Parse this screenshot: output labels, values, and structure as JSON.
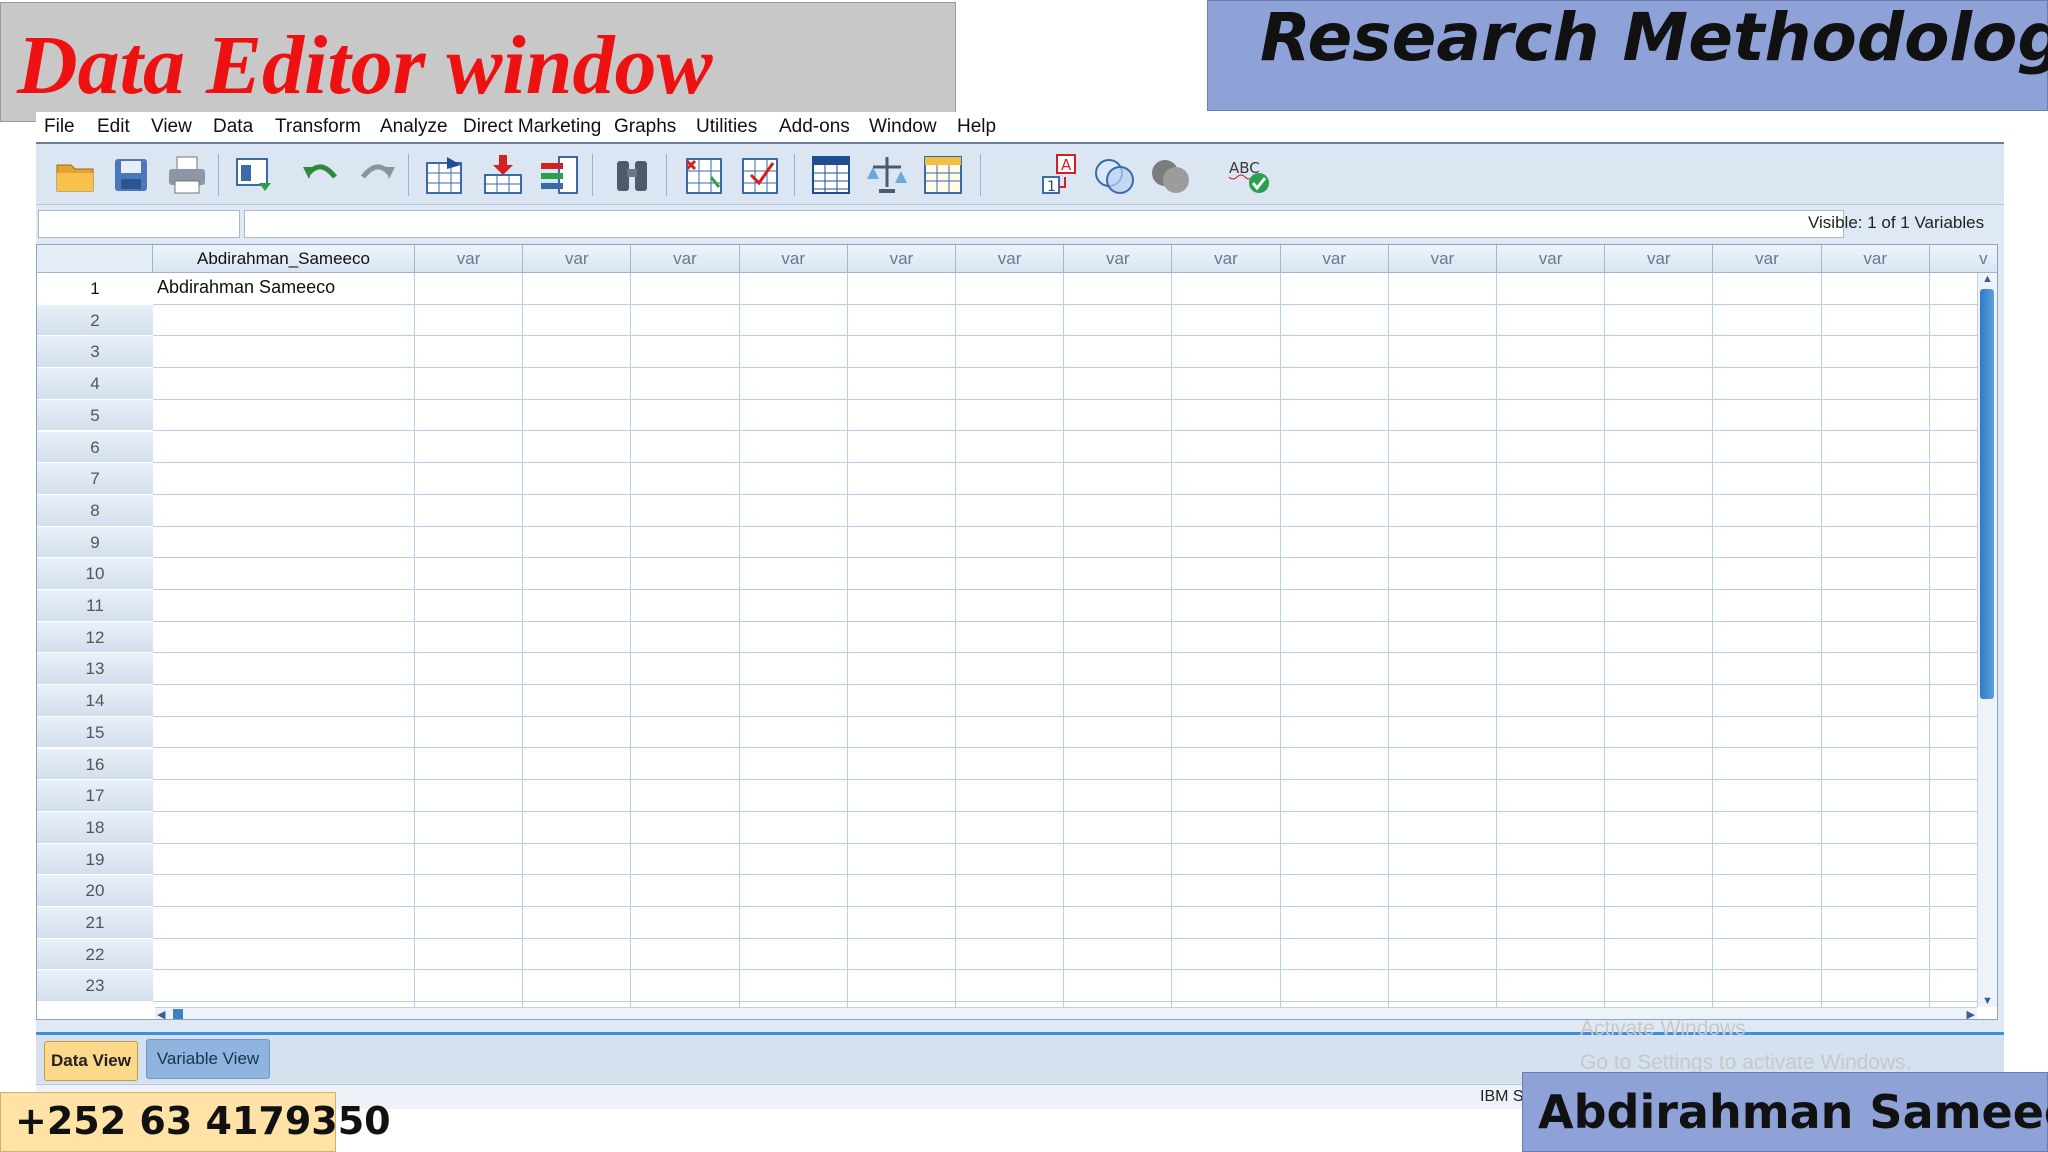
{
  "overlay": {
    "title": "Data Editor window",
    "course": "Research Methodology",
    "phone": "+252 63 4179350",
    "author": "Abdirahman Sameeco,"
  },
  "menu": [
    "File",
    "Edit",
    "View",
    "Data",
    "Transform",
    "Analyze",
    "Direct Marketing",
    "Graphs",
    "Utilities",
    "Add-ons",
    "Window",
    "Help"
  ],
  "toolbar": {
    "icons": [
      "open-folder-icon",
      "save-icon",
      "print-icon",
      "dialog-recall-icon",
      "undo-icon",
      "redo-icon",
      "goto-case-icon",
      "goto-variable-icon",
      "variables-icon",
      "find-icon",
      "insert-cases-icon",
      "insert-variable-icon",
      "split-file-icon",
      "weight-cases-icon",
      "select-cases-icon",
      "value-labels-icon",
      "use-sets-icon",
      "show-all-variables-icon",
      "spell-check-icon"
    ]
  },
  "status": {
    "visible": "Visible: 1 of 1 Variables",
    "footer": "IBM S"
  },
  "grid": {
    "columns": [
      "Abdirahman_Sameeco",
      "var",
      "var",
      "var",
      "var",
      "var",
      "var",
      "var",
      "var",
      "var",
      "var",
      "var",
      "var",
      "var",
      "var",
      "v"
    ],
    "rows": [
      "1",
      "2",
      "3",
      "4",
      "5",
      "6",
      "7",
      "8",
      "9",
      "10",
      "11",
      "12",
      "13",
      "14",
      "15",
      "16",
      "17",
      "18",
      "19",
      "20",
      "21",
      "22",
      "23"
    ],
    "cell_1_1": "Abdirahman Sameeco"
  },
  "tabs": {
    "data_view": "Data View",
    "variable_view": "Variable View"
  },
  "watermark": {
    "line1": "Activate Windows",
    "line2": "Go to Settings to activate Windows."
  },
  "colors": {
    "title_red": "#ee1111",
    "banner_blue": "#8ea2d8",
    "active_tab": "#fbd88a"
  }
}
